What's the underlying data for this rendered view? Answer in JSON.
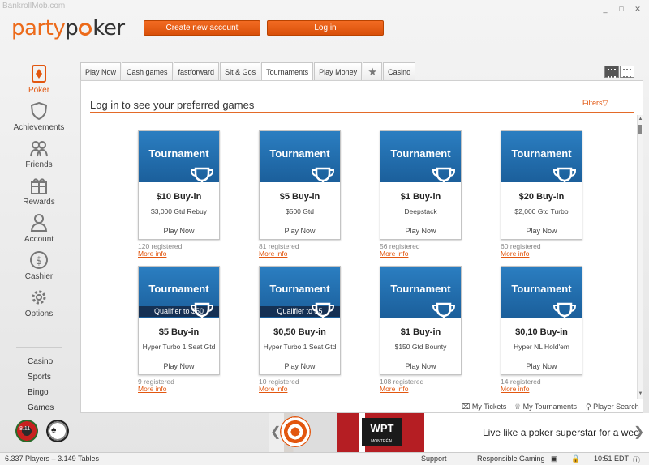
{
  "window": {
    "title": "BankrollMob.com",
    "controls": [
      "_",
      "□",
      "✕"
    ]
  },
  "brand": {
    "party": "party",
    "p": "p",
    "ker": "ker"
  },
  "header": {
    "create_account": "Create new account",
    "login": "Log in"
  },
  "sidebar": {
    "items": [
      {
        "label": "Poker",
        "icon": "poker-diamond-icon"
      },
      {
        "label": "Achievements",
        "icon": "shield-icon"
      },
      {
        "label": "Friends",
        "icon": "friends-icon"
      },
      {
        "label": "Rewards",
        "icon": "gift-icon"
      },
      {
        "label": "Account",
        "icon": "user-icon"
      },
      {
        "label": "Cashier",
        "icon": "dollar-icon"
      },
      {
        "label": "Options",
        "icon": "gear-icon"
      }
    ],
    "links": [
      "Casino",
      "Sports",
      "Bingo",
      "Games"
    ]
  },
  "tabs": [
    "Play Now",
    "Cash games",
    "fastforward",
    "Sit & Gos",
    "Tournaments",
    "Play Money",
    "★",
    "Casino"
  ],
  "panel": {
    "title": "Log in to see your preferred games",
    "filters": "Filters"
  },
  "cards": [
    {
      "head": "Tournament",
      "qualifier": "",
      "buyin": "$10 Buy-in",
      "desc": "$3,000 Gtd Rebuy",
      "play": "Play Now",
      "registered": "120 registered",
      "more": "More info"
    },
    {
      "head": "Tournament",
      "qualifier": "",
      "buyin": "$5 Buy-in",
      "desc": "$500 Gtd",
      "play": "Play Now",
      "registered": "81 registered",
      "more": "More info"
    },
    {
      "head": "Tournament",
      "qualifier": "",
      "buyin": "$1 Buy-in",
      "desc": "Deepstack",
      "play": "Play Now",
      "registered": "56 registered",
      "more": "More info"
    },
    {
      "head": "Tournament",
      "qualifier": "",
      "buyin": "$20 Buy-in",
      "desc": "$2,000 Gtd Turbo",
      "play": "Play Now",
      "registered": "60 registered",
      "more": "More info"
    },
    {
      "head": "Tournament",
      "qualifier": "Qualifier to $50",
      "buyin": "$5 Buy-in",
      "desc": "Hyper Turbo 1 Seat Gtd",
      "play": "Play Now",
      "registered": "9 registered",
      "more": "More info"
    },
    {
      "head": "Tournament",
      "qualifier": "Qualifier to $5",
      "buyin": "$0,50 Buy-in",
      "desc": "Hyper Turbo 1 Seat Gtd",
      "play": "Play Now",
      "registered": "10 registered",
      "more": "More info"
    },
    {
      "head": "Tournament",
      "qualifier": "",
      "buyin": "$1 Buy-in",
      "desc": "$150 Gtd Bounty",
      "play": "Play Now",
      "registered": "108 registered",
      "more": "More info"
    },
    {
      "head": "Tournament",
      "qualifier": "",
      "buyin": "$0,10 Buy-in",
      "desc": "Hyper NL Hold'em",
      "play": "Play Now",
      "registered": "14 registered",
      "more": "More info"
    }
  ],
  "bottom_links": [
    "My Tickets",
    "My Tournaments",
    "Player Search"
  ],
  "promo": {
    "text": "Live like a poker superstar for a wee",
    "wpt": "WPT",
    "wpt_sub": "MONTRÉAL"
  },
  "chips": {
    "a_label": "8.11",
    "b_label": "♠"
  },
  "status": {
    "players": "6.337 Players",
    "separator": "–",
    "tables": "3.149 Tables",
    "support": "Support",
    "responsible": "Responsible Gaming",
    "time": "10:51 EDT"
  },
  "colors": {
    "accent": "#e2560f",
    "card_blue": "#2b7ec1"
  }
}
